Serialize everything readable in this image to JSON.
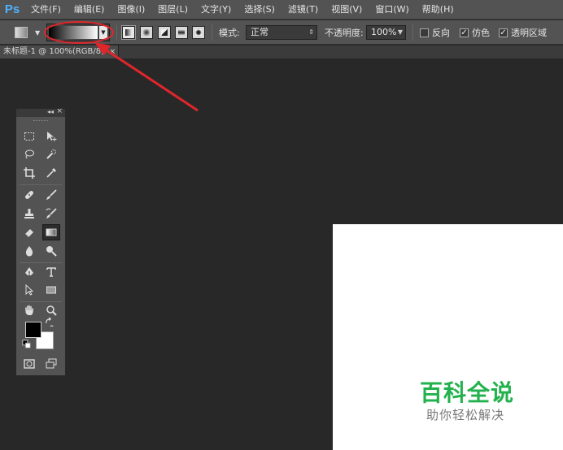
{
  "app": {
    "logo": "Ps"
  },
  "menu": [
    "文件(F)",
    "编辑(E)",
    "图像(I)",
    "图层(L)",
    "文字(Y)",
    "选择(S)",
    "滤镜(T)",
    "视图(V)",
    "窗口(W)",
    "帮助(H)"
  ],
  "options": {
    "mode_label": "模式:",
    "mode_value": "正常",
    "opacity_label": "不透明度:",
    "opacity_value": "100%",
    "reverse_label": "反向",
    "dither_label": "仿色",
    "transparency_label": "透明区域",
    "reverse_checked": false,
    "dither_checked": true,
    "transparency_checked": true,
    "gradient_types": [
      "linear-gradient-icon",
      "radial-gradient-icon",
      "angle-gradient-icon",
      "reflected-gradient-icon",
      "diamond-gradient-icon"
    ]
  },
  "document": {
    "tab_title": "未标题-1 @ 100%(RGB/8)",
    "close_glyph": "×"
  },
  "toolpanel": {
    "collapse_glyph": "◂◂",
    "close_glyph": "×",
    "active_tool": "gradient-tool"
  },
  "watermark": {
    "title": "百科全说",
    "subtitle": "助你轻松解决"
  },
  "colors": {
    "accent_blue": "#4fb3ff",
    "annotation_red": "#e0262b",
    "watermark_green": "#22b14c",
    "foreground": "#000000",
    "background": "#ffffff"
  }
}
